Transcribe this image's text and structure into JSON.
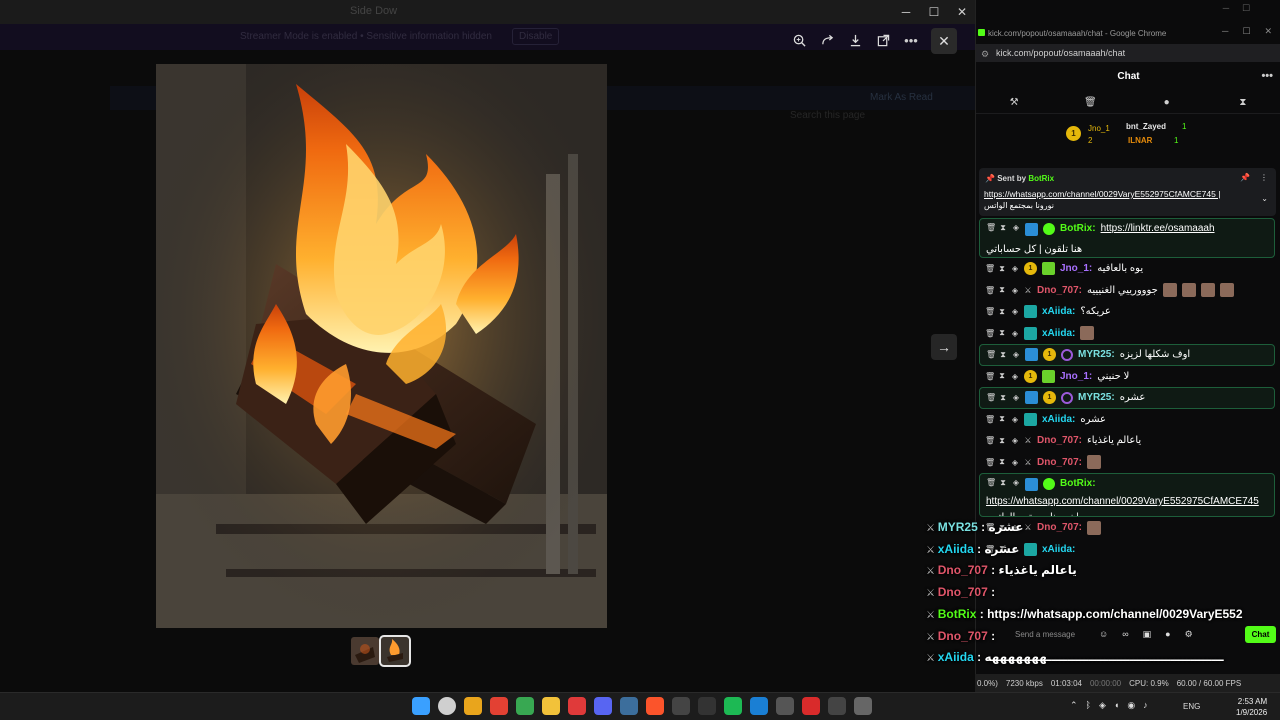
{
  "background_app": {
    "title": "Side Dow",
    "banner_text": "Streamer Mode is enabled • Sensitive information hidden",
    "banner_button": "Disable",
    "search_placeholder": "Search this page",
    "strip_left": "",
    "strip_right": "Mark As Read"
  },
  "viewer": {
    "toolbar_icons": [
      "zoom-in-icon",
      "rotate-icon",
      "download-icon",
      "open-external-icon",
      "more-icon"
    ],
    "close_label": "✕",
    "next_label": "→",
    "thumbnail_count": 2
  },
  "chrome_window": {
    "title": "kick.com/popout/osamaaah/chat - Google Chrome",
    "url": "kick.com/popout/osamaaah/chat"
  },
  "chat": {
    "header": "Chat",
    "leaderboard": {
      "first_name": "Jno_1",
      "first_count": "2",
      "second_name": "bnt_Zayed",
      "second_count": "1",
      "third_name": "ILNAR",
      "third_count": "1"
    },
    "pinned": {
      "sent_by": "Sent by",
      "bot_name": "BotRix",
      "link": "https://whatsapp.com/channel/0029VaryE552975CfAMCE745 |",
      "arabic": "نورونا بمجتمع الواتس"
    },
    "messages": [
      {
        "user": "BotRix",
        "cls": "u-bot",
        "text": "https://linktr.ee/osamaaah",
        "extra": "هنا تلقون | كل حساباتي",
        "hl": true,
        "tall": true,
        "bot": true
      },
      {
        "user": "Jno_1",
        "cls": "u-jno",
        "text": "يوه بالعافيه",
        "badge": "gift"
      },
      {
        "user": "Dno_707",
        "cls": "u-dno",
        "text": "جووورييي الغنيييه",
        "emotes": 4
      },
      {
        "user": "xAiida",
        "cls": "u-xai",
        "text": "عريكه؟",
        "badge": "teal"
      },
      {
        "user": "xAiida",
        "cls": "u-xai",
        "text": "",
        "emotes": 1,
        "badge": "teal"
      },
      {
        "user": "MYR25",
        "cls": "u-myr",
        "text": "اوف شكلها لزيزه",
        "hl": true,
        "badge": "myr"
      },
      {
        "user": "Jno_1",
        "cls": "u-jno",
        "text": "لا حنيني",
        "badge": "gift"
      },
      {
        "user": "MYR25",
        "cls": "u-myr",
        "text": "عشره",
        "hl": true,
        "badge": "myr"
      },
      {
        "user": "xAiida",
        "cls": "u-xai",
        "text": "عشره",
        "badge": "teal"
      },
      {
        "user": "Dno_707",
        "cls": "u-dno",
        "text": "ياعالم ياغذياء"
      },
      {
        "user": "Dno_707",
        "cls": "u-dno",
        "text": "",
        "emotes": 1
      },
      {
        "user": "BotRix",
        "cls": "u-bot",
        "text": "https://whatsapp.com/channel/0029VaryE552975CfAMCE745",
        "extra": "نورونا بمجتمع الواتس |",
        "hl": true,
        "tall2": true,
        "bot": true
      },
      {
        "user": "Dno_707",
        "cls": "u-dno",
        "text": "",
        "emotes": 1
      },
      {
        "user": "xAiida",
        "cls": "u-xai",
        "text": "",
        "badge": "teal"
      }
    ],
    "input_placeholder": "Send a message",
    "chat_button": "Chat"
  },
  "overlay_messages": [
    {
      "user": "MYR25",
      "text": ": عشره",
      "color": "#7ae0e0"
    },
    {
      "user": "xAiida",
      "text": ": عشره",
      "color": "#24d7f0"
    },
    {
      "user": "Dno_707",
      "text": ": ياعالم ياغذياء",
      "color": "#e0566a"
    },
    {
      "user": "Dno_707",
      "text": ":",
      "color": "#e0566a"
    },
    {
      "user": "BotRix",
      "text": ": https://whatsapp.com/channel/0029VaryE552",
      "color": "#53fc18"
    },
    {
      "user": "Dno_707",
      "text": ":",
      "color": "#e0566a"
    },
    {
      "user": "xAiida",
      "text": ": ـــــــــــــــــــــــــــــــــــــــــــهههههههه",
      "color": "#24d7f0"
    }
  ],
  "obs_stats": {
    "drop": "0.0%)",
    "bitrate": "7230 kbps",
    "time_live": "01:03:04",
    "time_rec": "00:00:00",
    "cpu": "CPU: 0.9%",
    "fps": "60.00 / 60.00 FPS"
  },
  "taskbar": {
    "lang": "ENG",
    "time": "2:53 AM",
    "date": "1/9/2026"
  },
  "colors": {
    "kick_green": "#53fc18",
    "gold": "#e5b80b"
  }
}
